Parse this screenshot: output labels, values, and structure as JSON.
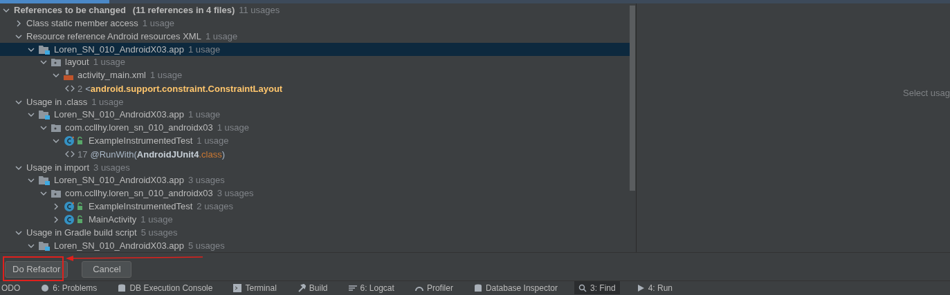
{
  "tree": [
    {
      "kind": "category",
      "label": "References to be changed",
      "detail": "(11 references in 4 files)",
      "count": "11 usages",
      "expanded": true,
      "selected": false,
      "children": [
        {
          "kind": "category",
          "label": "Class static member access",
          "count": "1 usage",
          "expanded": false,
          "selected": false
        },
        {
          "kind": "category",
          "label": "Resource reference Android resources XML",
          "count": "1 usage",
          "expanded": true,
          "selected": false,
          "children": [
            {
              "kind": "module",
              "label": "Loren_SN_010_AndroidX03.app",
              "count": "1 usage",
              "expanded": true,
              "selected": true,
              "children": [
                {
                  "kind": "package",
                  "label": "layout",
                  "count": "1 usage",
                  "expanded": true,
                  "selected": false,
                  "children": [
                    {
                      "kind": "xml_file",
                      "label": "activity_main.xml",
                      "count": "1 usage",
                      "expanded": true,
                      "selected": false,
                      "children": [
                        {
                          "kind": "code",
                          "line": "2",
                          "selected": false,
                          "segments": [
                            {
                              "kind": "plain",
                              "text": "<"
                            },
                            {
                              "kind": "match",
                              "text": "android.support.constraint.ConstraintLayout"
                            }
                          ]
                        }
                      ]
                    }
                  ]
                }
              ]
            }
          ]
        },
        {
          "kind": "category",
          "label": "Usage in .class",
          "count": "1 usage",
          "expanded": true,
          "selected": false,
          "children": [
            {
              "kind": "module",
              "label": "Loren_SN_010_AndroidX03.app",
              "count": "1 usage",
              "expanded": true,
              "selected": false,
              "children": [
                {
                  "kind": "package",
                  "label": "com.ccllhy.loren_sn_010_androidx03",
                  "count": "1 usage",
                  "expanded": true,
                  "selected": false,
                  "children": [
                    {
                      "kind": "test_class",
                      "label": "ExampleInstrumentedTest",
                      "count": "1 usage",
                      "expanded": true,
                      "selected": false,
                      "children": [
                        {
                          "kind": "code",
                          "line": "17",
                          "selected": false,
                          "segments": [
                            {
                              "kind": "plain",
                              "text": "@RunWith("
                            },
                            {
                              "kind": "bold",
                              "text": "AndroidJUnit4"
                            },
                            {
                              "kind": "keyword",
                              "text": ".class"
                            },
                            {
                              "kind": "plain",
                              "text": ")"
                            }
                          ]
                        }
                      ]
                    }
                  ]
                }
              ]
            }
          ]
        },
        {
          "kind": "category",
          "label": "Usage in import",
          "count": "3 usages",
          "expanded": true,
          "selected": false,
          "children": [
            {
              "kind": "module",
              "label": "Loren_SN_010_AndroidX03.app",
              "count": "3 usages",
              "expanded": true,
              "selected": false,
              "children": [
                {
                  "kind": "package",
                  "label": "com.ccllhy.loren_sn_010_androidx03",
                  "count": "3 usages",
                  "expanded": true,
                  "selected": false,
                  "children": [
                    {
                      "kind": "test_class",
                      "label": "ExampleInstrumentedTest",
                      "count": "2 usages",
                      "expanded": false,
                      "selected": false
                    },
                    {
                      "kind": "class",
                      "label": "MainActivity",
                      "count": "1 usage",
                      "expanded": false,
                      "selected": false
                    }
                  ]
                }
              ]
            }
          ]
        },
        {
          "kind": "category",
          "label": "Usage in Gradle build script",
          "count": "5 usages",
          "expanded": true,
          "selected": false,
          "children": [
            {
              "kind": "module",
              "label": "Loren_SN_010_AndroidX03.app",
              "count": "5 usages",
              "expanded": true,
              "selected": false
            }
          ]
        }
      ]
    }
  ],
  "preview": {
    "message": "Select usag"
  },
  "buttons": [
    {
      "label": "Do Refactor",
      "annotated": true
    },
    {
      "label": "Cancel"
    }
  ],
  "tool_windows": [
    {
      "label": "ODO",
      "kind": "none",
      "selected": false
    },
    {
      "label": "6: Problems",
      "kind": "problems",
      "selected": false
    },
    {
      "label": "DB Execution Console",
      "kind": "db",
      "selected": false
    },
    {
      "label": "Terminal",
      "kind": "terminal",
      "selected": false
    },
    {
      "label": "Build",
      "kind": "build",
      "selected": false
    },
    {
      "label": "6: Logcat",
      "kind": "logcat",
      "selected": false
    },
    {
      "label": "Profiler",
      "kind": "profiler",
      "selected": false
    },
    {
      "label": "Database Inspector",
      "kind": "db",
      "selected": false
    },
    {
      "label": "3: Find",
      "kind": "search",
      "selected": true
    },
    {
      "label": "4: Run",
      "kind": "run",
      "selected": false
    }
  ]
}
